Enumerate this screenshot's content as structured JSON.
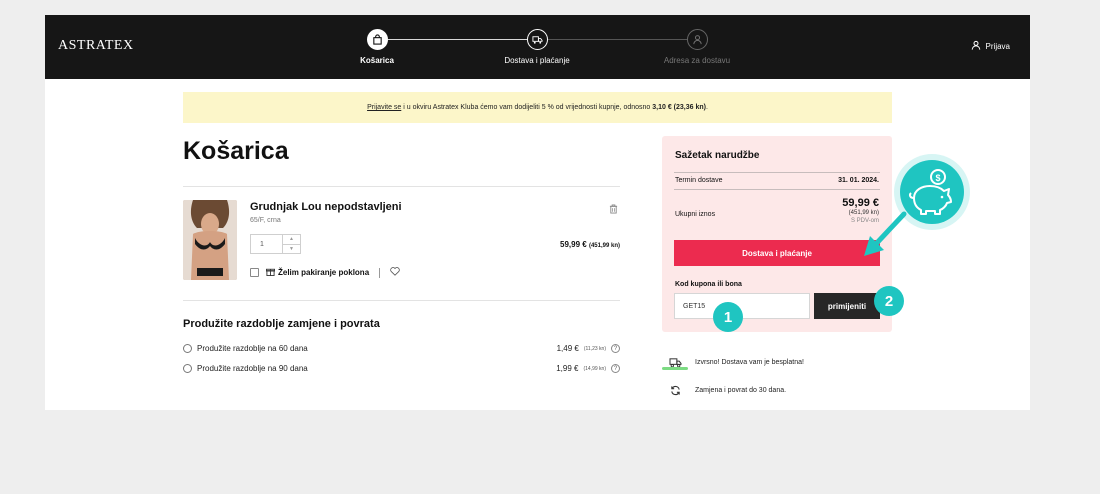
{
  "header": {
    "logo": "ASTRATEX",
    "login": "Prijava",
    "steps": [
      {
        "label": "Košarica",
        "icon": "bag-icon",
        "state": "active"
      },
      {
        "label": "Dostava i plaćanje",
        "icon": "truck-icon",
        "state": "mid"
      },
      {
        "label": "Adresa za dostavu",
        "icon": "user-icon",
        "state": "off"
      }
    ]
  },
  "banner": {
    "link": "Prijavite se",
    "text": " i u okviru Astratex Kluba ćemo vam dodijeliti 5 % od vrijednosti kupnje, odnosno ",
    "amount": "3,10 € (23,36 kn)",
    "end": "."
  },
  "cart": {
    "title": "Košarica",
    "product": {
      "name": "Grudnjak Lou nepodstavljeni",
      "variant": "65/F, crna",
      "quantity": "1",
      "price": "59,99 €",
      "price_kn": "(451,99 kn)",
      "gift_label": "Želim pakiranje poklona"
    },
    "extension": {
      "title": "Produžite razdoblje zamjene i povrata",
      "options": [
        {
          "label": "Produžite razdoblje na 60 dana",
          "price": "1,49 €",
          "price_kn": "(11,23 kn)"
        },
        {
          "label": "Produžite razdoblje na 90 dana",
          "price": "1,99 €",
          "price_kn": "(14,99 kn)"
        }
      ]
    }
  },
  "summary": {
    "title": "Sažetak narudžbe",
    "delivery_label": "Termin dostave",
    "delivery_date": "31. 01. 2024.",
    "total_label": "Ukupni iznos",
    "total": "59,99 €",
    "total_kn": "(451,99 kn)",
    "vat": "S PDV-om",
    "pay_button": "Dostava i plaćanje",
    "coupon_label": "Kod kupona ili bona",
    "coupon_value": "GET15",
    "apply_button": "primijeniti"
  },
  "info": [
    {
      "icon": "truck-icon",
      "text": "Izvrsno! Dostava vam je besplatna!"
    },
    {
      "icon": "refresh-icon",
      "text": "Zamjena i povrat do 30 dana."
    }
  ],
  "overlay": {
    "badge1": "1",
    "badge2": "2",
    "accent": "#1fc5c1"
  }
}
